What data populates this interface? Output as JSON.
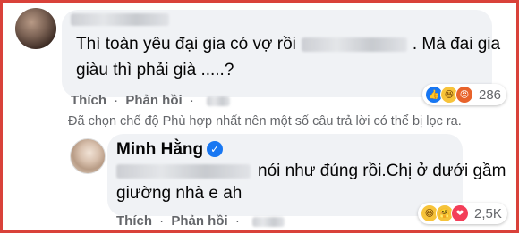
{
  "comment1": {
    "text_line1_a": "Thì toàn yêu đại gia có vợ rồi",
    "text_line1_b": ". Mà đai gia",
    "text_line2": "giàu thì phải già .....?",
    "actions": {
      "like": "Thích",
      "sep": "·",
      "reply": "Phản hồi"
    },
    "reactions": {
      "count": "286",
      "icons": [
        "like-icon",
        "haha-icon",
        "angry-icon"
      ]
    }
  },
  "filter_notice": "Đã chọn chế độ Phù hợp nhất nên một số câu trả lời có thể bị lọc ra.",
  "comment2": {
    "author": "Minh Hằng",
    "verified_glyph": "✓",
    "text_line1": "nói như đúng rồi.Chị ở dưới gầm",
    "text_line2": "giường nhà e ah",
    "actions": {
      "like": "Thích",
      "sep": "·",
      "reply": "Phản hồi"
    },
    "reactions": {
      "count": "2,5K",
      "icons": [
        "haha-icon",
        "care-icon",
        "love-icon"
      ]
    }
  },
  "colors": {
    "frame": "#d9413a",
    "bubble": "#f0f2f5",
    "meta": "#65676b",
    "verified": "#1877f2"
  }
}
